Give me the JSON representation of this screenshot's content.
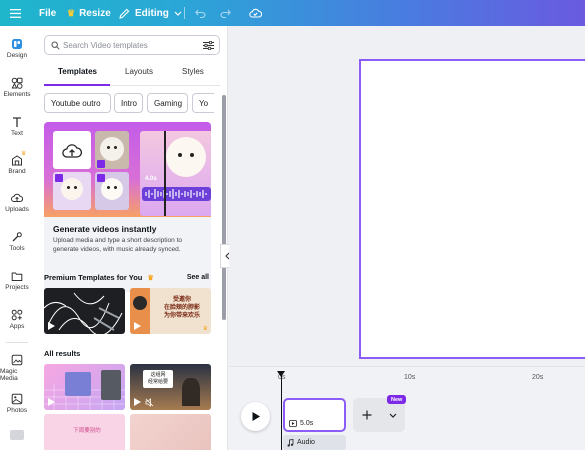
{
  "topbar": {
    "file_label": "File",
    "resize_label": "Resize",
    "editing_label": "Editing"
  },
  "rail": {
    "items": [
      {
        "label": "Design",
        "icon": "design-icon"
      },
      {
        "label": "Elements",
        "icon": "elements-icon"
      },
      {
        "label": "Text",
        "icon": "text-icon"
      },
      {
        "label": "Brand",
        "icon": "brand-icon"
      },
      {
        "label": "Uploads",
        "icon": "uploads-icon"
      },
      {
        "label": "Tools",
        "icon": "tools-icon"
      },
      {
        "label": "Projects",
        "icon": "projects-icon"
      },
      {
        "label": "Apps",
        "icon": "apps-icon"
      },
      {
        "label": "Magic Media",
        "icon": "magic-media-icon"
      },
      {
        "label": "Photos",
        "icon": "photos-icon"
      }
    ]
  },
  "panel": {
    "search_placeholder": "Search Video templates",
    "tabs": [
      "Templates",
      "Layouts",
      "Styles"
    ],
    "chips": [
      "Youtube outro",
      "Intro",
      "Gaming",
      "Yo"
    ],
    "promo": {
      "duration": "4.0s",
      "title": "Generate videos instantly",
      "description": "Upload media and type a short description to generate videos, with music already synced."
    },
    "premium": {
      "title": "Premium Templates for You",
      "see_all": "See all",
      "thumb2_text": "受邀你\n在脸颊的脖影\n为你带来欢乐"
    },
    "all_results": {
      "title": "All results",
      "thumb2_text": "这组网\n经常给要",
      "thumb3_text": "下周要别的"
    }
  },
  "timeline": {
    "ticks": [
      "0s",
      "10s",
      "20s"
    ],
    "clip_duration": "5.0s",
    "audio_label": "Audio",
    "new_badge": "New"
  },
  "colors": {
    "accent": "#8b5cf6",
    "brand_purple": "#7d2ae8",
    "topbar_start": "#1fb6cc",
    "topbar_end": "#6a5ae0"
  }
}
